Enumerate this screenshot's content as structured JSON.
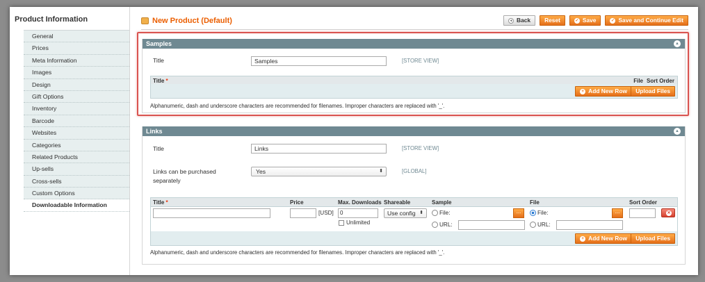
{
  "sidebar": {
    "title": "Product Information",
    "tabs": [
      "General",
      "Prices",
      "Meta Information",
      "Images",
      "Design",
      "Gift Options",
      "Inventory",
      "Barcode",
      "Websites",
      "Categories",
      "Related Products",
      "Up-sells",
      "Cross-sells",
      "Custom Options",
      "Downloadable Information"
    ],
    "active_tab": "Downloadable Information"
  },
  "header": {
    "title": "New Product (Default)",
    "back_label": "Back",
    "reset_label": "Reset",
    "save_label": "Save",
    "save_continue_label": "Save and Continue Edit"
  },
  "samples": {
    "section_title": "Samples",
    "title_label": "Title",
    "title_value": "Samples",
    "title_scope": "[STORE VIEW]",
    "grid_col_title": "Title",
    "grid_col_file": "File",
    "grid_col_sort": "Sort Order",
    "add_row_label": "Add New Row",
    "upload_label": "Upload Files",
    "note": "Alphanumeric, dash and underscore characters are recommended for filenames. Improper characters are replaced with '_'."
  },
  "links": {
    "section_title": "Links",
    "title_label": "Title",
    "title_value": "Links",
    "title_scope": "[STORE VIEW]",
    "purchase_label_line1": "Links can be purchased",
    "purchase_label_line2": "separately",
    "purchase_value": "Yes",
    "purchase_scope": "[GLOBAL]",
    "cols": {
      "title": "Title",
      "price": "Price",
      "max_downloads": "Max. Downloads",
      "shareable": "Shareable",
      "sample": "Sample",
      "file": "File",
      "sort_order": "Sort Order"
    },
    "row": {
      "title_value": "",
      "currency": "[USD]",
      "max_downloads_value": "0",
      "unlimited_label": "Unlimited",
      "shareable_value": "Use config",
      "sample_file_label": "File:",
      "sample_url_label": "URL:",
      "file_file_label": "File:",
      "file_url_label": "URL:",
      "dots": "..."
    },
    "add_row_label": "Add New Row",
    "upload_label": "Upload Files",
    "note": "Alphanumeric, dash and underscore characters are recommended for filenames. Improper characters are replaced with '_'."
  },
  "colors": {
    "accent": "#eb5e00",
    "section_header": "#6f8992",
    "highlight": "#d9534f"
  }
}
